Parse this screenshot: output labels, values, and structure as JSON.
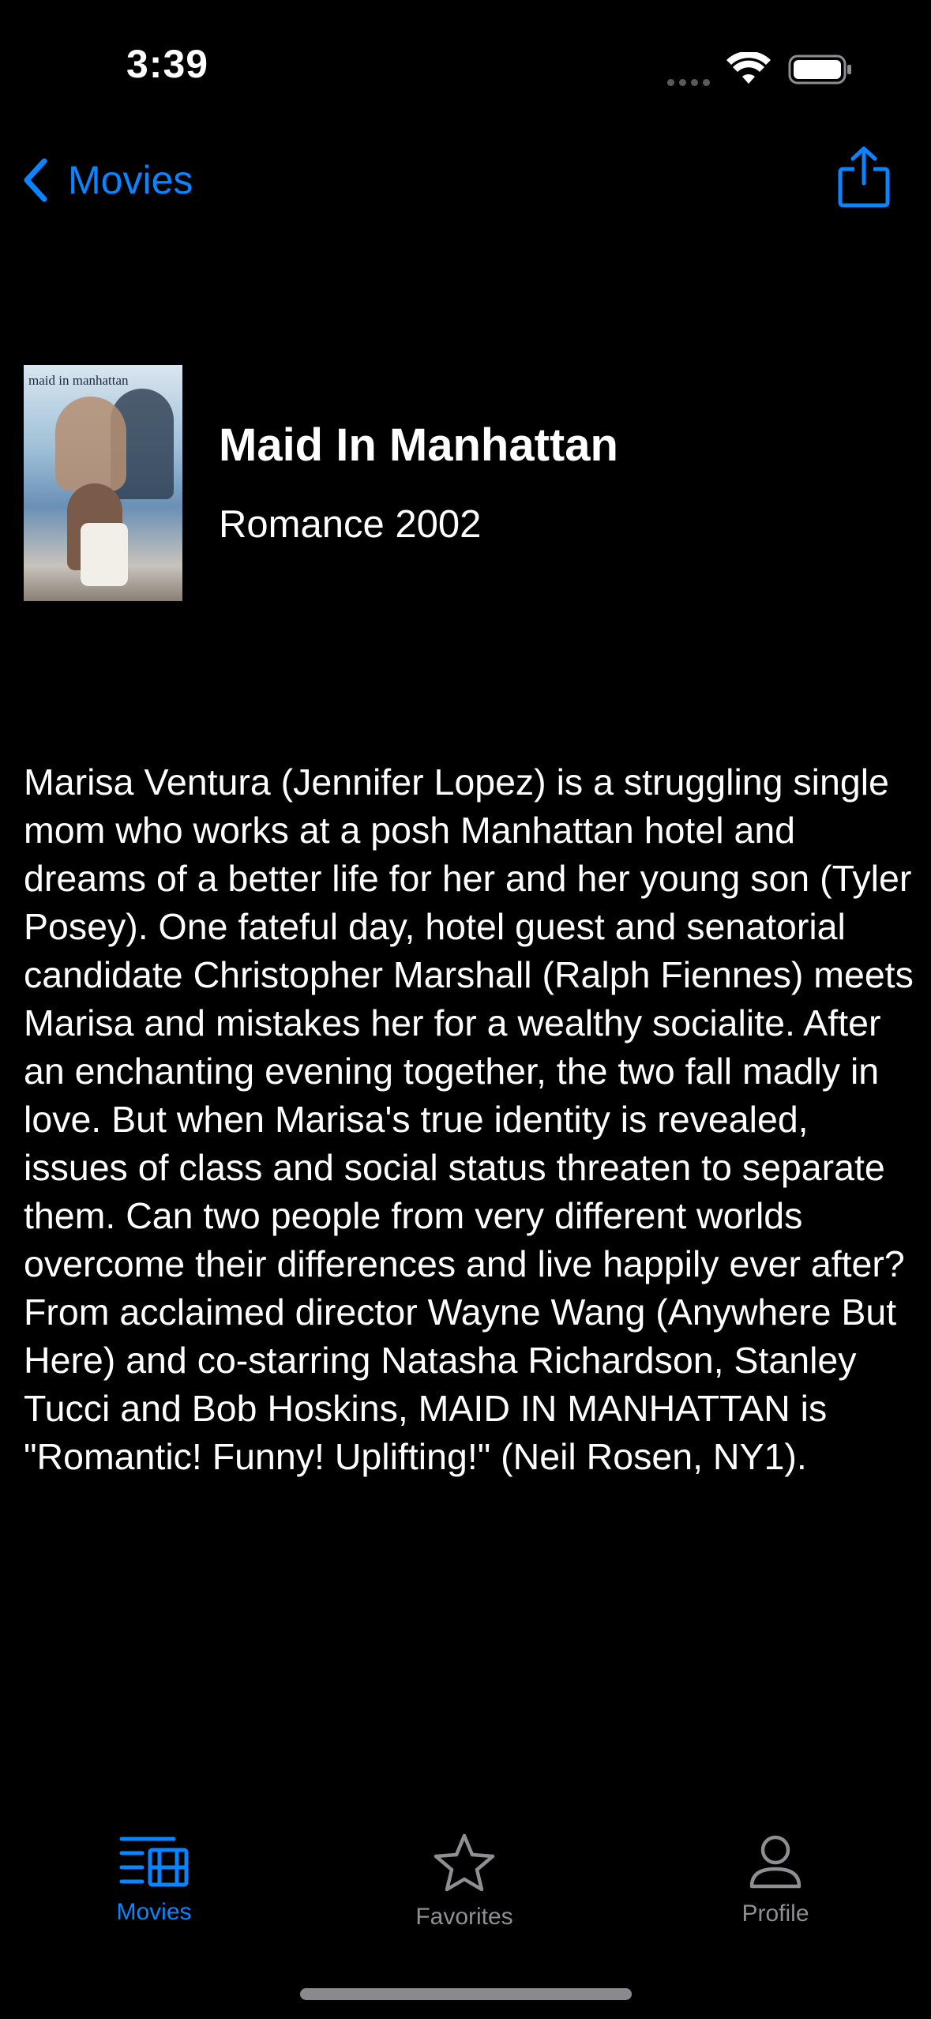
{
  "status_bar": {
    "time": "3:39",
    "icons": [
      "signal-dots-icon",
      "wifi-icon",
      "battery-icon"
    ]
  },
  "nav": {
    "back_label": "Movies",
    "back_icon": "chevron-left-icon",
    "share_icon": "share-icon"
  },
  "movie": {
    "poster_text": "maid in manhattan",
    "title": "Maid In Manhattan",
    "meta": "Romance 2002",
    "description": "Marisa Ventura (Jennifer Lopez) is a struggling single mom who works at a posh Manhattan hotel and dreams of a better life for her and her young son (Tyler Posey). One fateful day, hotel guest and senatorial candidate Christopher Marshall (Ralph Fiennes) meets Marisa and mistakes her for a wealthy socialite. After an enchanting evening together, the two fall madly in love. But when Marisa's true identity is revealed, issues of class and social status threaten to separate them. Can two people from very different worlds overcome their differences and live happily ever after? From acclaimed director Wayne Wang (Anywhere But Here) and co-starring Natasha Richardson, Stanley Tucci and Bob Hoskins, MAID IN MANHATTAN is \"Romantic! Funny! Uplifting!\" (Neil Rosen, NY1)."
  },
  "tab_bar": {
    "tabs": [
      {
        "label": "Movies",
        "icon": "film-list-icon",
        "active": true
      },
      {
        "label": "Favorites",
        "icon": "star-icon",
        "active": false
      },
      {
        "label": "Profile",
        "icon": "person-icon",
        "active": false
      }
    ]
  },
  "colors": {
    "background": "#000000",
    "accent": "#0a84ff",
    "inactive": "#8e8e93",
    "text": "#ffffff"
  }
}
